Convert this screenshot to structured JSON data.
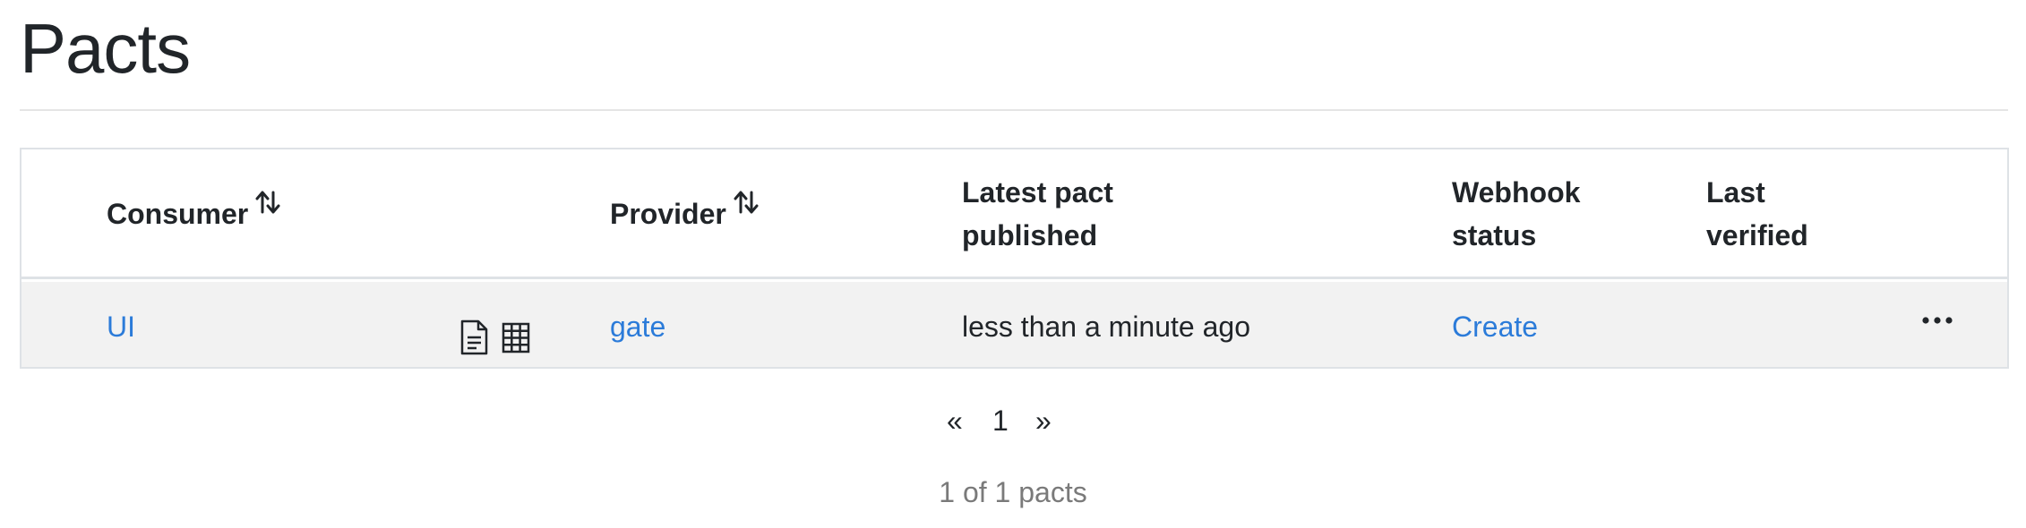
{
  "page": {
    "title": "Pacts"
  },
  "table": {
    "headers": {
      "consumer": "Consumer",
      "provider": "Provider",
      "latest_pact_line1": "Latest pact",
      "latest_pact_line2": "published",
      "webhook_line1": "Webhook",
      "webhook_line2": "status",
      "verified_line1": "Last",
      "verified_line2": "verified"
    },
    "rows": [
      {
        "consumer": "UI",
        "provider": "gate",
        "latest_pact_published": "less than a minute ago",
        "webhook_status": "Create",
        "last_verified": "",
        "icons": [
          "document-icon",
          "matrix-icon"
        ],
        "menu": "more-options-icon"
      }
    ]
  },
  "pagination": {
    "prev": "«",
    "current": "1",
    "next": "»"
  },
  "summary": "1 of 1 pacts",
  "colors": {
    "link": "#2b7bd9",
    "row_bg": "#f2f2f2",
    "border": "#dee2e6",
    "muted": "#7a7a7a"
  }
}
